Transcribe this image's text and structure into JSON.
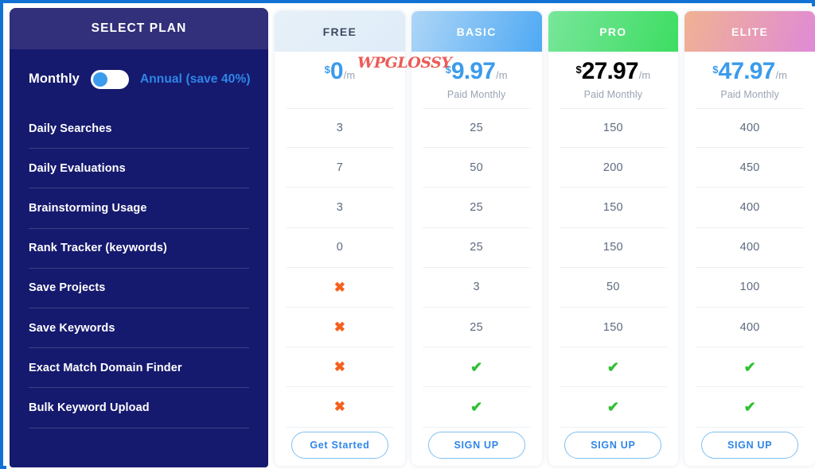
{
  "theme": {
    "frame_border": "#1272d4",
    "panel_bg": "#151a6e",
    "panel_head_bg": "#32307a",
    "accent_blue": "#2f86e8",
    "check_green": "#2fc032",
    "cross_orange": "#f4601d"
  },
  "watermark": {
    "text": "WPGLOSSY"
  },
  "sidebar": {
    "title": "SELECT PLAN",
    "billing": {
      "monthly_label": "Monthly",
      "annual_label": "Annual (save 40%)",
      "toggle_state": "monthly"
    },
    "features": [
      "Daily Searches",
      "Daily Evaluations",
      "Brainstorming Usage",
      "Rank Tracker (keywords)",
      "Save Projects",
      "Save Keywords",
      "Exact Match Domain Finder",
      "Bulk Keyword Upload"
    ]
  },
  "plans": [
    {
      "name": "FREE",
      "head_bg": "linear-gradient(135deg,#e6f0f8 0%,#dfecf8 100%)",
      "name_color": "#3d4a63",
      "currency": "$",
      "price": "0",
      "per": "/m",
      "price_color": "#3b9bec",
      "note": "",
      "cta": "Get Started",
      "values": [
        "3",
        "7",
        "3",
        "0",
        "✖",
        "✖",
        "✖",
        "✖"
      ]
    },
    {
      "name": "BASIC",
      "head_bg": "linear-gradient(110deg,#aed6f7 0%,#4fa9f3 100%)",
      "name_color": "#ffffff",
      "currency": "$",
      "price": "9.97",
      "per": "/m",
      "price_color": "#3b9bec",
      "note": "Paid Monthly",
      "cta": "SIGN UP",
      "values": [
        "25",
        "50",
        "25",
        "25",
        "3",
        "25",
        "✔",
        "✔"
      ]
    },
    {
      "name": "PRO",
      "head_bg": "linear-gradient(110deg,#78e69a 0%,#3ddd62 100%)",
      "name_color": "#ffffff",
      "currency": "$",
      "price": "27.97",
      "per": "/m",
      "price_color": "#3ad košice",
      "note": "Paid Monthly",
      "cta": "SIGN UP",
      "values": [
        "150",
        "200",
        "150",
        "150",
        "50",
        "150",
        "✔",
        "✔"
      ]
    },
    {
      "name": "ELITE",
      "head_bg": "linear-gradient(110deg,#f0b292 0%,#e08ad6 100%)",
      "name_color": "#ffffff",
      "currency": "$",
      "price": "47.97",
      "per": "/m",
      "price_color": "#3b9bec",
      "note": "Paid Monthly",
      "cta": "SIGN UP",
      "values": [
        "400",
        "450",
        "400",
        "400",
        "100",
        "400",
        "✔",
        "✔"
      ]
    }
  ]
}
